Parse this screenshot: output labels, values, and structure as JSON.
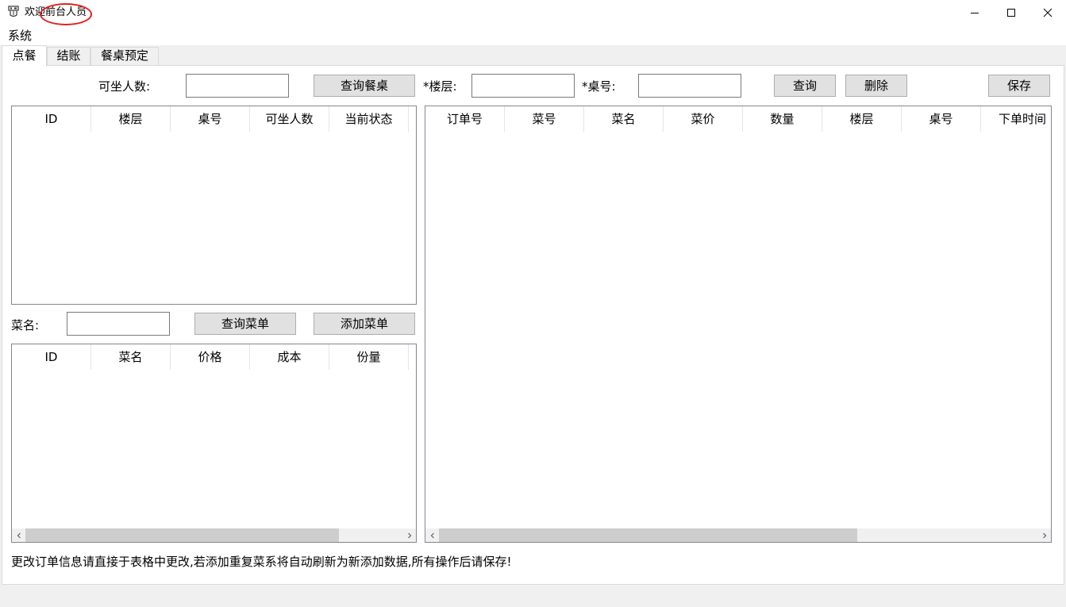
{
  "window": {
    "title_prefix": "欢迎",
    "title_user": "前台人员"
  },
  "menu": {
    "system": "系统"
  },
  "tabs": [
    {
      "label": "点餐"
    },
    {
      "label": "结账"
    },
    {
      "label": "餐桌预定"
    }
  ],
  "order_tab": {
    "seats_label": "可坐人数:",
    "seats_value": "",
    "query_tables_button": "查询餐桌",
    "floor_label": "*楼层:",
    "floor_value": "",
    "table_no_label": "*桌号:",
    "table_no_value": "",
    "query_button": "查询",
    "delete_button": "删除",
    "save_button": "保存",
    "tables_grid": {
      "columns": [
        "ID",
        "楼层",
        "桌号",
        "可坐人数",
        "当前状态"
      ]
    },
    "dish_name_label": "菜名:",
    "dish_name_value": "",
    "query_menu_button": "查询菜单",
    "add_menu_button": "添加菜单",
    "menu_grid": {
      "columns": [
        "ID",
        "菜名",
        "价格",
        "成本",
        "份量"
      ]
    },
    "orders_grid": {
      "columns": [
        "订单号",
        "菜号",
        "菜名",
        "菜价",
        "数量",
        "楼层",
        "桌号",
        "下单时间"
      ]
    },
    "hint_text": "更改订单信息请直接于表格中更改,若添加重复菜系将自动刷新为新添加数据,所有操作后请保存!"
  }
}
